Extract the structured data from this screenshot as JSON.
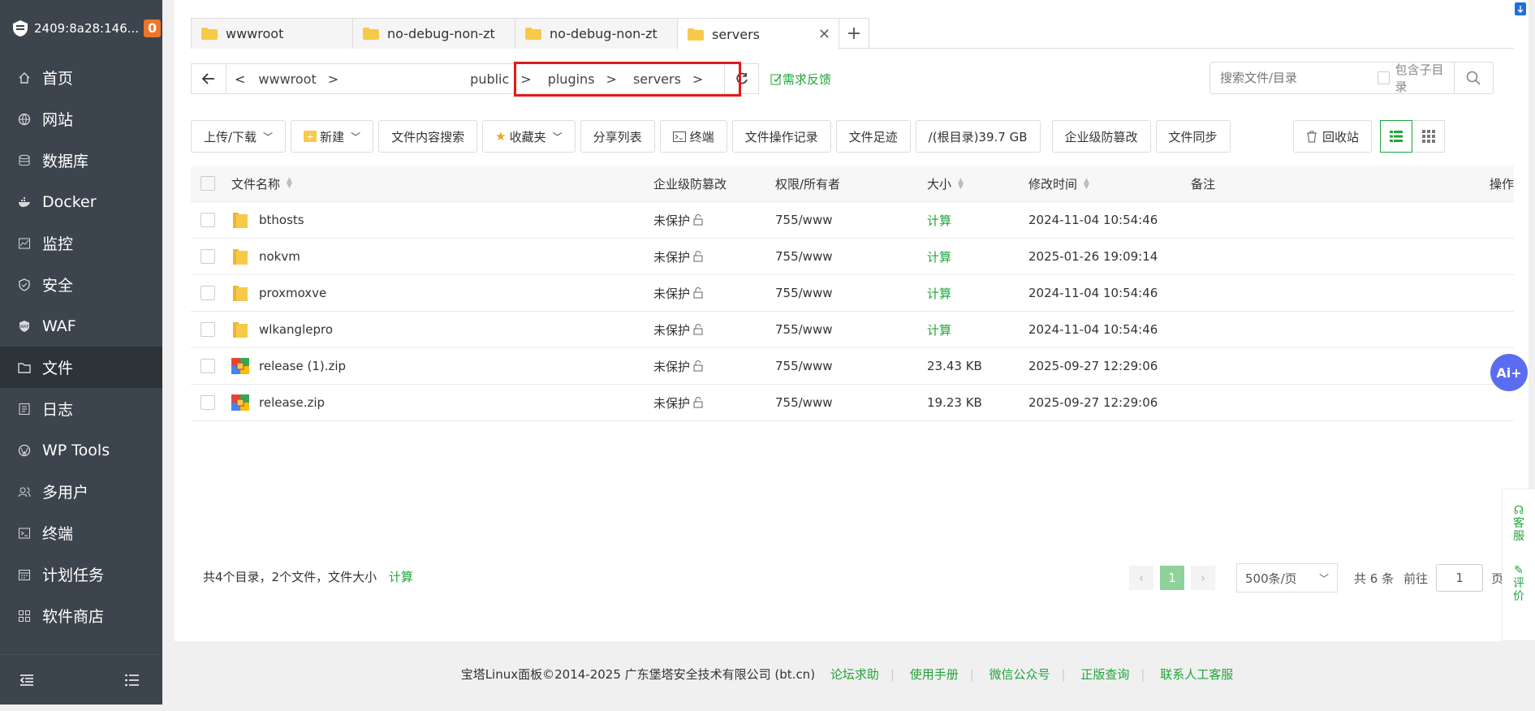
{
  "sidebar": {
    "server": "2409:8a28:146...",
    "badge": "0",
    "items": [
      {
        "label": "首页",
        "icon": "home-icon"
      },
      {
        "label": "网站",
        "icon": "globe-icon"
      },
      {
        "label": "数据库",
        "icon": "database-icon"
      },
      {
        "label": "Docker",
        "icon": "docker-icon"
      },
      {
        "label": "监控",
        "icon": "monitor-icon"
      },
      {
        "label": "安全",
        "icon": "shield-icon"
      },
      {
        "label": "WAF",
        "icon": "waf-icon"
      },
      {
        "label": "文件",
        "icon": "folder-icon",
        "active": true
      },
      {
        "label": "日志",
        "icon": "log-icon"
      },
      {
        "label": "WP Tools",
        "icon": "wordpress-icon"
      },
      {
        "label": "多用户",
        "icon": "users-icon"
      },
      {
        "label": "终端",
        "icon": "terminal-icon"
      },
      {
        "label": "计划任务",
        "icon": "calendar-icon"
      },
      {
        "label": "软件商店",
        "icon": "apps-icon"
      }
    ]
  },
  "tabs": [
    {
      "label": "wwwroot"
    },
    {
      "label": "no-debug-non-zt"
    },
    {
      "label": "no-debug-non-zt"
    },
    {
      "label": "servers",
      "active": true
    }
  ],
  "path": {
    "crumbs": [
      "wwwroot",
      "public",
      "plugins",
      "servers"
    ],
    "feedback": "需求反馈"
  },
  "search": {
    "placeholder": "搜索文件/目录",
    "subdir_label": "包含子目录"
  },
  "toolbar": {
    "upload": "上传/下载",
    "new": "新建",
    "content_search": "文件内容搜索",
    "favorites": "收藏夹",
    "share_list": "分享列表",
    "terminal": "终端",
    "op_log": "文件操作记录",
    "footprint": "文件足迹",
    "disk": "/(根目录)39.7 GB",
    "tamper": "企业级防篡改",
    "sync": "文件同步",
    "recycle": "回收站"
  },
  "table": {
    "headers": {
      "name": "文件名称",
      "protect": "企业级防篡改",
      "perm": "权限/所有者",
      "size": "大小",
      "mtime": "修改时间",
      "note": "备注",
      "op": "操作"
    },
    "rows": [
      {
        "name": "bthosts",
        "type": "folder",
        "protect": "未保护",
        "perm": "755/www",
        "size": "计算",
        "mtime": "2024-11-04 10:54:46"
      },
      {
        "name": "nokvm",
        "type": "folder",
        "protect": "未保护",
        "perm": "755/www",
        "size": "计算",
        "mtime": "2025-01-26 19:09:14"
      },
      {
        "name": "proxmoxve",
        "type": "folder",
        "protect": "未保护",
        "perm": "755/www",
        "size": "计算",
        "mtime": "2024-11-04 10:54:46"
      },
      {
        "name": "wlkanglepro",
        "type": "folder",
        "protect": "未保护",
        "perm": "755/www",
        "size": "计算",
        "mtime": "2024-11-04 10:54:46"
      },
      {
        "name": "release (1).zip",
        "type": "zip",
        "protect": "未保护",
        "perm": "755/www",
        "size": "23.43 KB",
        "mtime": "2025-09-27 12:29:06"
      },
      {
        "name": "release.zip",
        "type": "zip",
        "protect": "未保护",
        "perm": "755/www",
        "size": "19.23 KB",
        "mtime": "2025-09-27 12:29:06"
      }
    ]
  },
  "summary": {
    "text": "共4个目录，2个文件，文件大小",
    "calc": "计算"
  },
  "pager": {
    "current": "1",
    "page_size": "500条/页",
    "total": "共 6 条",
    "goto_label": "前往",
    "goto_value": "1",
    "page_suffix": "页"
  },
  "footer": {
    "copyright": "宝塔Linux面板©2014-2025 广东堡塔安全技术有限公司 (bt.cn)",
    "links": [
      "论坛求助",
      "使用手册",
      "微信公众号",
      "正版查询",
      "联系人工客服"
    ]
  },
  "floating": {
    "ai": "Ai+",
    "service": "客服",
    "review": "评价"
  },
  "colors": {
    "accent": "#20a53a",
    "sidebar": "#3c444d",
    "highlight": "#e01b1b"
  }
}
